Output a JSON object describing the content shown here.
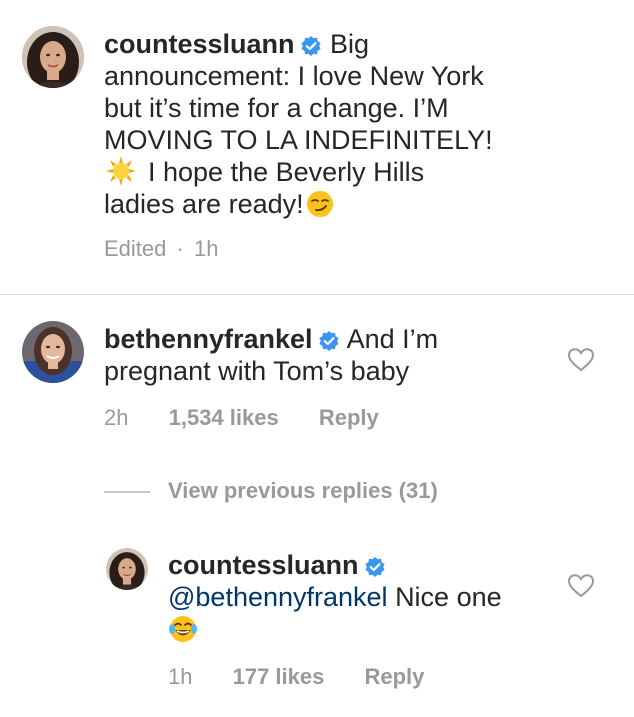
{
  "comments": [
    {
      "username": "countessluann",
      "verified": true,
      "text_lines": [
        "Big",
        "announcement: I love New York",
        "but it’s time for a change. I’M",
        "MOVING TO LA INDEFINITELY!",
        "I hope the Beverly Hills",
        "ladies are ready!"
      ],
      "emojis": [
        "sun-emoji",
        "smirk-emoji"
      ],
      "edited": "Edited",
      "separator": "·",
      "time": "1h"
    },
    {
      "username": "bethennyfrankel",
      "verified": true,
      "text_lines": [
        "And I’m",
        "pregnant with Tom’s baby"
      ],
      "time": "2h",
      "likes": "1,534 likes",
      "reply_label": "Reply",
      "liked": false
    }
  ],
  "view_previous_replies": "View previous replies (31)",
  "reply": {
    "username": "countessluann",
    "verified": true,
    "mention": "@bethennyfrankel",
    "text": "Nice one",
    "emoji": "joy-emoji",
    "time": "1h",
    "likes": "177 likes",
    "reply_label": "Reply",
    "liked": false
  },
  "colors": {
    "text": "#262626",
    "secondary": "#999999",
    "mention": "#003569",
    "verified_badge": "#3897f0",
    "divider": "#dbdbdb"
  }
}
